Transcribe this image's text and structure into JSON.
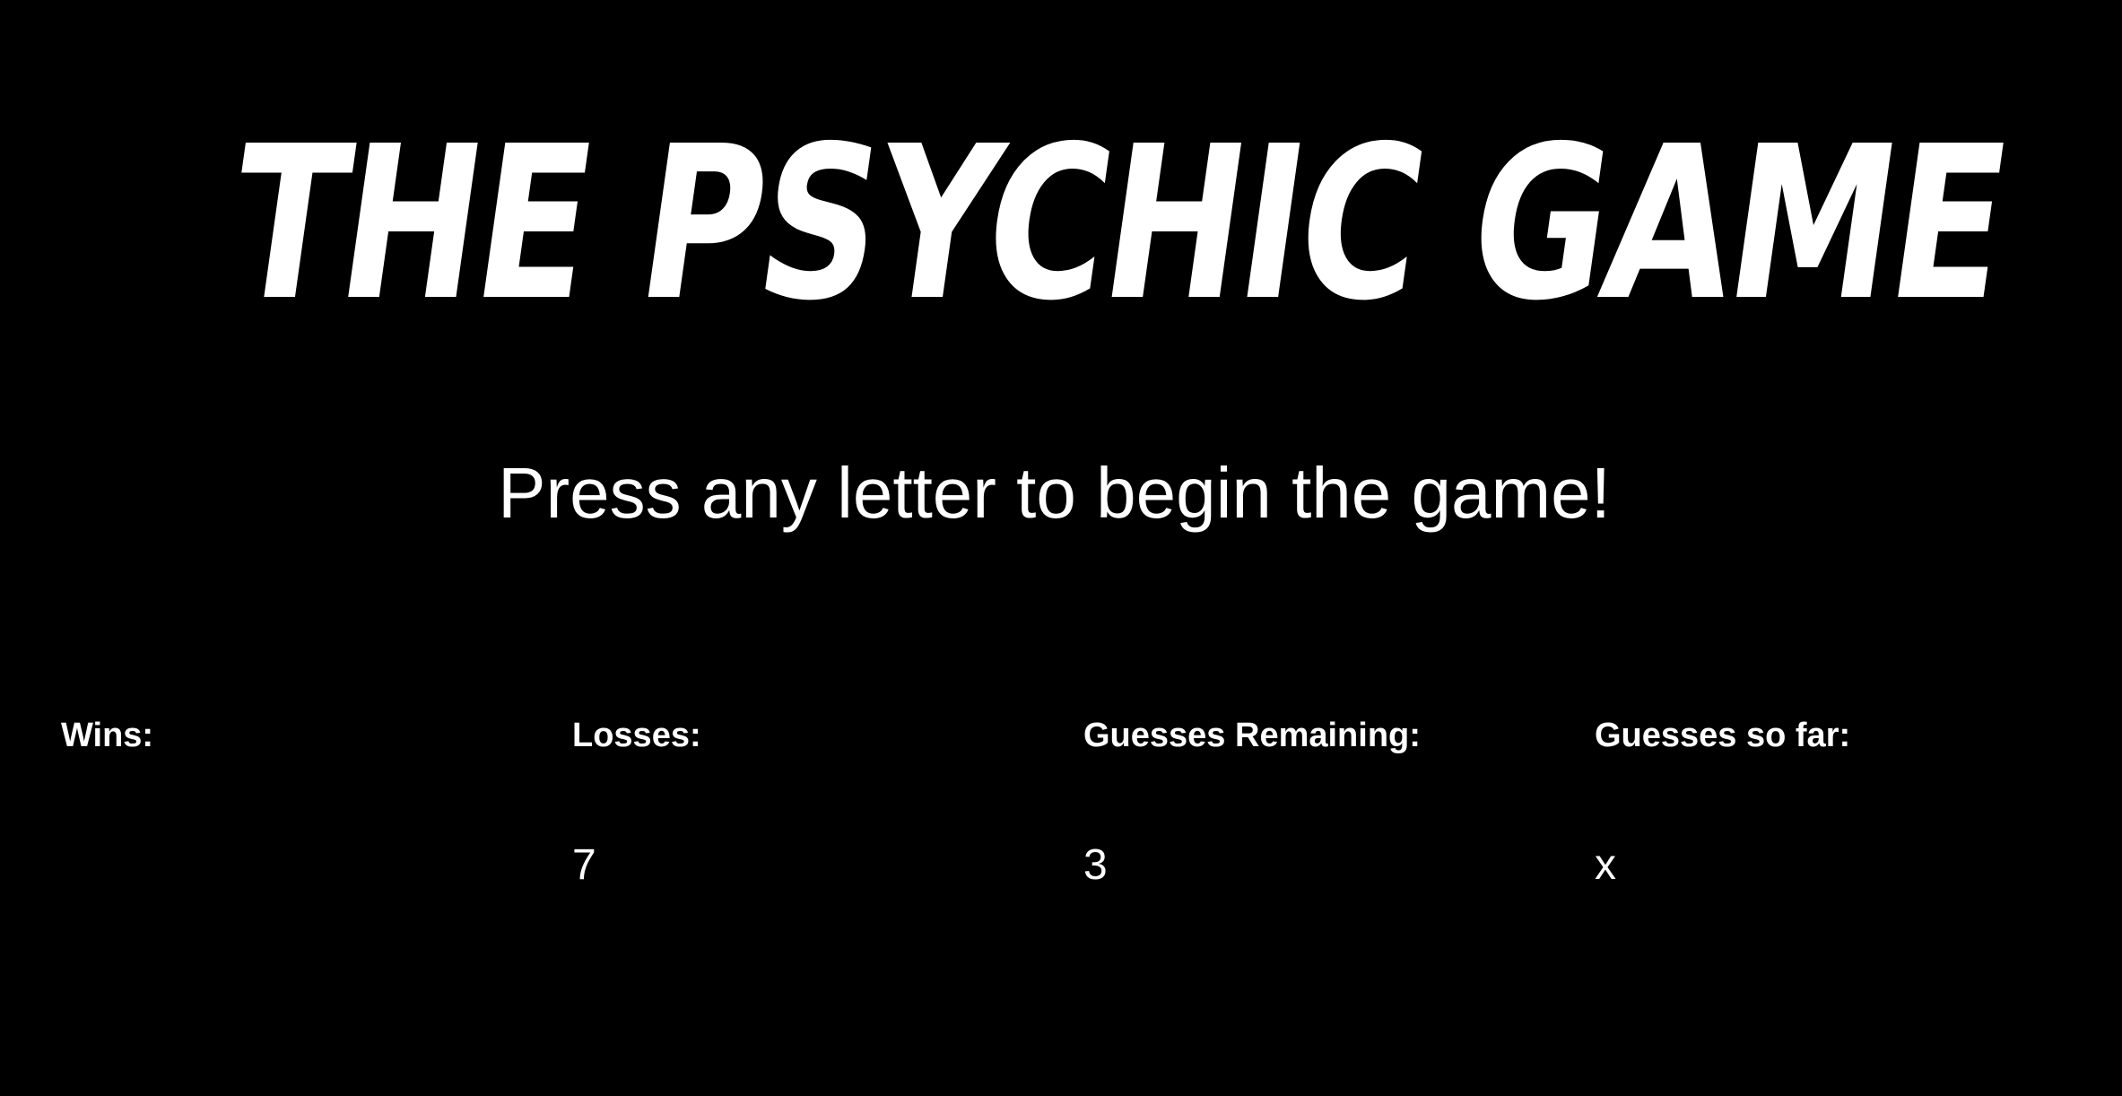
{
  "title": "The Psychic Game",
  "instructions": "Press any letter to begin the game!",
  "stats": {
    "wins": {
      "label": "Wins:",
      "value": ""
    },
    "losses": {
      "label": "Losses:",
      "value": "7"
    },
    "guesses_remaining": {
      "label": "Guesses Remaining:",
      "value": "3"
    },
    "guesses_so_far": {
      "label": "Guesses so far:",
      "value": "x"
    }
  },
  "colors": {
    "background": "#000000",
    "text": "#ffffff"
  }
}
